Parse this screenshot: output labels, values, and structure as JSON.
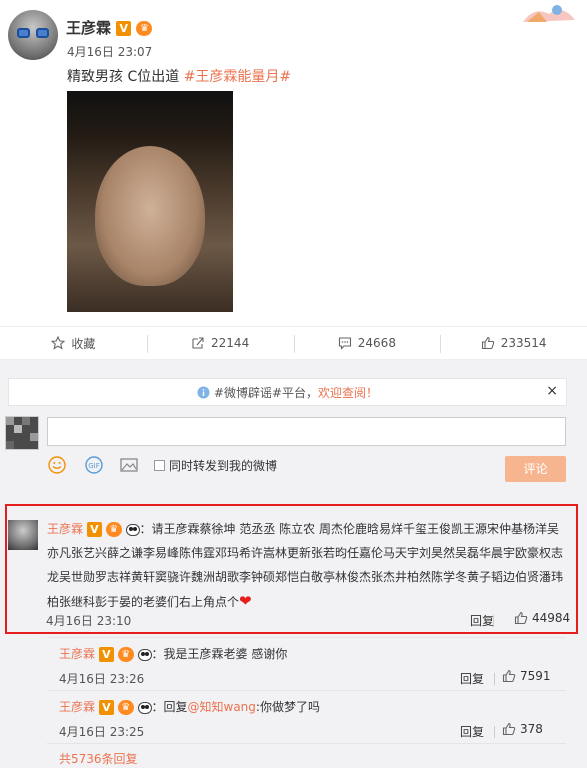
{
  "post": {
    "author": "王彦霖",
    "vip_badge": "V",
    "time": "4月16日 23:07",
    "text": "精致男孩 C位出道 ",
    "topic": "#王彦霖能量月#"
  },
  "actions": [
    {
      "icon": "star-icon",
      "label": "收藏"
    },
    {
      "icon": "share-icon",
      "label": "22144"
    },
    {
      "icon": "comment-icon",
      "label": "24668"
    },
    {
      "icon": "like-icon",
      "label": "233514"
    }
  ],
  "notice": {
    "prefix": "#微博辟谣#平台，",
    "link": "欢迎查阅！",
    "close": "×"
  },
  "composer": {
    "repost_label": "同时转发到我的微博",
    "submit": "评论"
  },
  "comment": {
    "author": "王彦霖",
    "text": "：请王彦霖蔡徐坤 范丞丞 陈立农 周杰伦鹿晗易烊千玺王俊凯王源宋仲基杨洋吴亦凡张艺兴薛之谦李易峰陈伟霆邓玛希许嵩林更新张若昀任嘉伦马天宇刘昊然吴磊华晨宇欧豪权志龙吴世勋罗志祥黄轩窦骁许魏洲胡歌李钟硕郑恺白敬亭林俊杰张杰井柏然陈学冬黄子韬边伯贤潘玮柏张继科彭于晏的老婆们右上角点个",
    "heart": "❤",
    "time": "4月16日 23:10",
    "reply": "回复",
    "likes": "44984"
  },
  "subcomments": [
    {
      "author": "王彦霖",
      "text": "：我是王彦霖老婆 感谢你",
      "mention": "",
      "after": "",
      "time": "4月16日 23:26",
      "reply": "回复",
      "likes": "7591"
    },
    {
      "author": "王彦霖",
      "text": "：回复",
      "mention": "@知知wang",
      "after": ":你做梦了吗",
      "time": "4月16日 23:25",
      "reply": "回复",
      "likes": "378"
    }
  ],
  "more_replies": "共5736条回复",
  "colors": {
    "accent": "#eb7350",
    "highlight": "#e51d1d",
    "vip": "#f29100"
  }
}
